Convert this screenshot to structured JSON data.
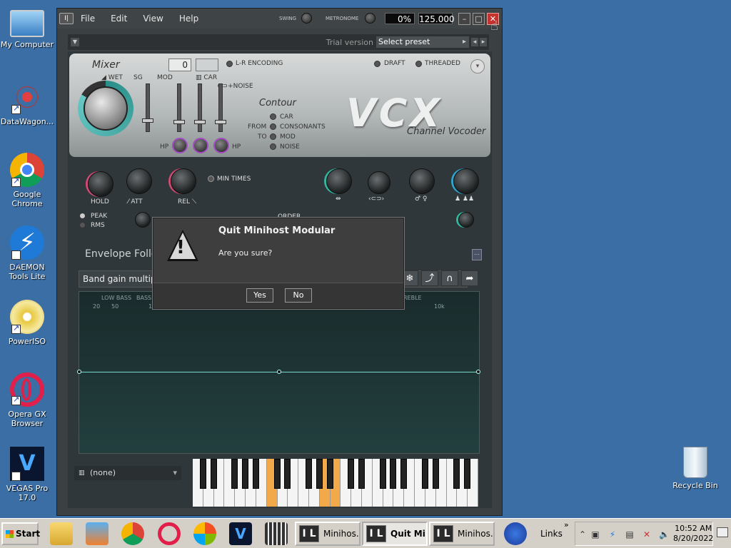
{
  "desktop": {
    "icons": [
      {
        "label": "My Computer"
      },
      {
        "label": "DataWagon..."
      },
      {
        "label": "Google Chrome"
      },
      {
        "label": "DAEMON Tools Lite"
      },
      {
        "label": "PowerISO"
      },
      {
        "label": "Opera GX Browser"
      },
      {
        "label": "VEGAS Pro 17.0"
      },
      {
        "label": "Recycle Bin"
      }
    ]
  },
  "window": {
    "menu": [
      "File",
      "Edit",
      "View",
      "Help"
    ],
    "swing_label": "SWING",
    "metronome_label": "METRONOME",
    "cpu_value": "0%",
    "tempo_value": "125.000",
    "trial_text": "Trial version",
    "preset_text": "Select preset"
  },
  "plugin": {
    "mixer_title": "Mixer",
    "wet_label": "WET",
    "sg_label": "SG",
    "mod_label": "MOD",
    "car_label": "CAR",
    "noise_label": "+NOISE",
    "hp_left": "HP",
    "hp_right": "HP",
    "value_box": "0",
    "lr_encoding": "L-R ENCODING",
    "draft": "DRAFT",
    "threaded": "THREADED",
    "contour_title": "Contour",
    "from_label": "FROM",
    "to_label": "TO",
    "contour_options": [
      "CAR",
      "CONSONANTS",
      "MOD",
      "NOISE"
    ],
    "logo": "VCX",
    "subtitle": "Channel Vocoder",
    "hold_label": "HOLD",
    "att_label": "ATT",
    "rel_label": "REL",
    "min_times": "MIN TIMES",
    "peak_label": "PEAK",
    "rms_label": "RMS",
    "order_label": "ORDER",
    "envelope_title": "Envelope Follow",
    "band_gain": "Band gain multipli",
    "freq_labels": {
      "low_bass": "LOW BASS",
      "bass": "BASS",
      "treble": "REBLE",
      "f20": "20",
      "f50": "50",
      "f1": "1",
      "f10k": "10k"
    },
    "none_select": "(none)"
  },
  "dialog": {
    "title": "Quit Minihost Modular",
    "message": "Are you sure?",
    "yes": "Yes",
    "no": "No"
  },
  "taskbar": {
    "start": "Start",
    "tasks": [
      "Minihos...",
      "Quit Mi...",
      "Minihos..."
    ],
    "links": "Links",
    "time": "10:52 AM",
    "date": "8/20/2022"
  }
}
